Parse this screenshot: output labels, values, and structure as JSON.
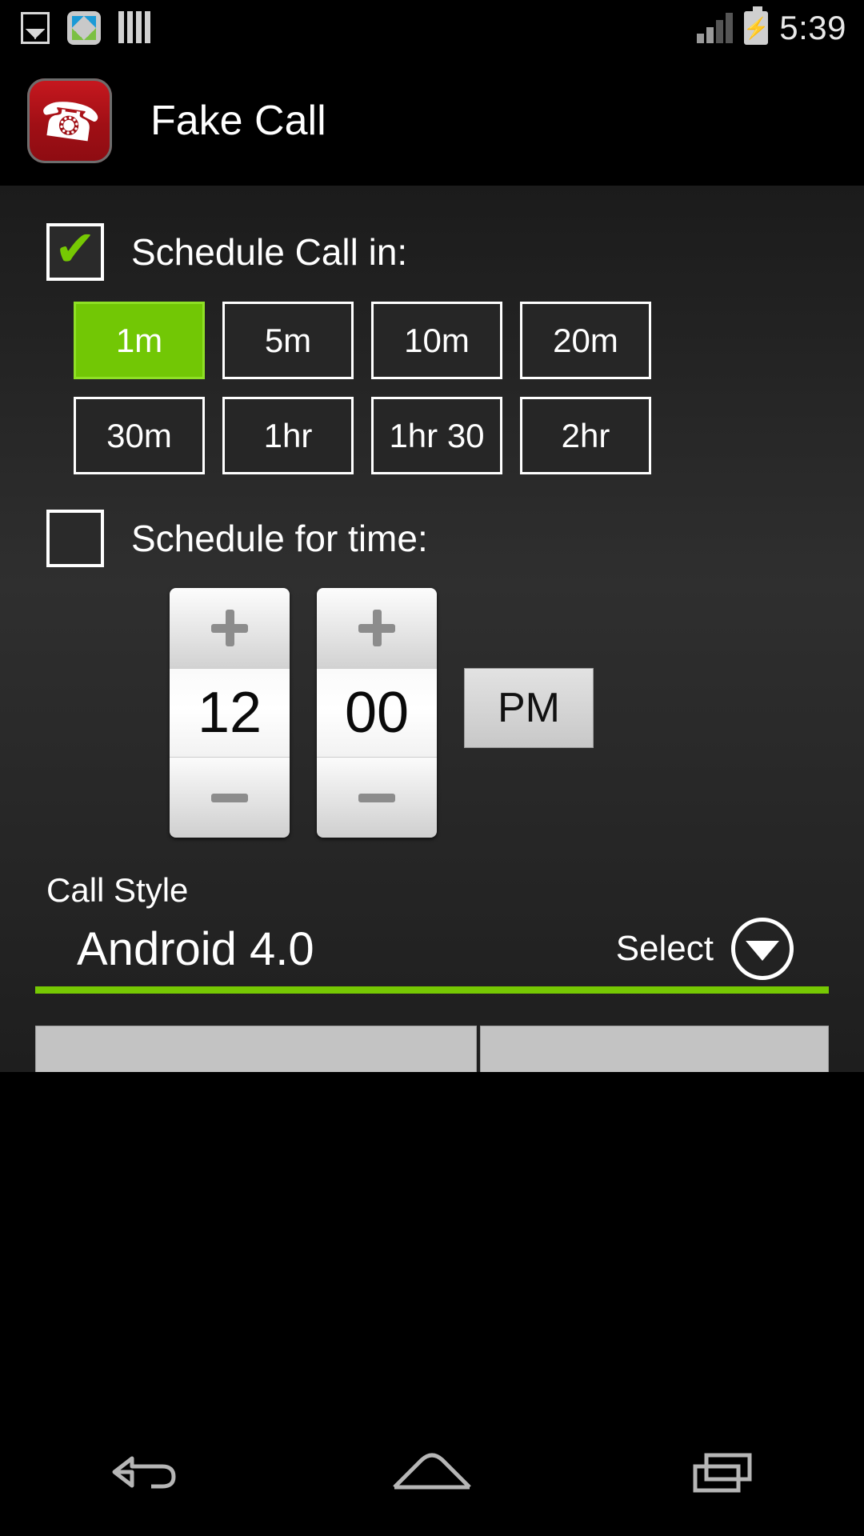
{
  "statusbar": {
    "time": "5:39",
    "icons": [
      "gallery-icon",
      "xender-app-icon",
      "bars-icon"
    ],
    "signal_icon": "signal-bars-icon",
    "battery_icon": "battery-charging-icon"
  },
  "appbar": {
    "title": "Fake Call",
    "icon": "phone-handset-icon",
    "icon_color": "#b01016"
  },
  "schedule_in": {
    "checkbox_checked": true,
    "label": "Schedule Call in:",
    "selected_index": 0,
    "accent_color": "#72c705",
    "options": [
      {
        "label": "1m",
        "selected": true
      },
      {
        "label": "5m",
        "selected": false
      },
      {
        "label": "10m",
        "selected": false
      },
      {
        "label": "20m",
        "selected": false
      },
      {
        "label": "30m",
        "selected": false
      },
      {
        "label": "1hr",
        "selected": false
      },
      {
        "label": "1hr 30",
        "selected": false
      },
      {
        "label": "2hr",
        "selected": false
      }
    ]
  },
  "schedule_time": {
    "checkbox_checked": false,
    "label": "Schedule for time:",
    "hour": "12",
    "minute": "00",
    "ampm": "PM",
    "increment_label": "+",
    "decrement_label": "−"
  },
  "call_style": {
    "label": "Call Style",
    "value": "Android 4.0",
    "select_label": "Select",
    "underline_color": "#76c803",
    "dropdown_icon": "chevron-down-circle-icon"
  },
  "navbar": {
    "back": "back-icon",
    "home": "home-icon",
    "recents": "recents-icon"
  }
}
